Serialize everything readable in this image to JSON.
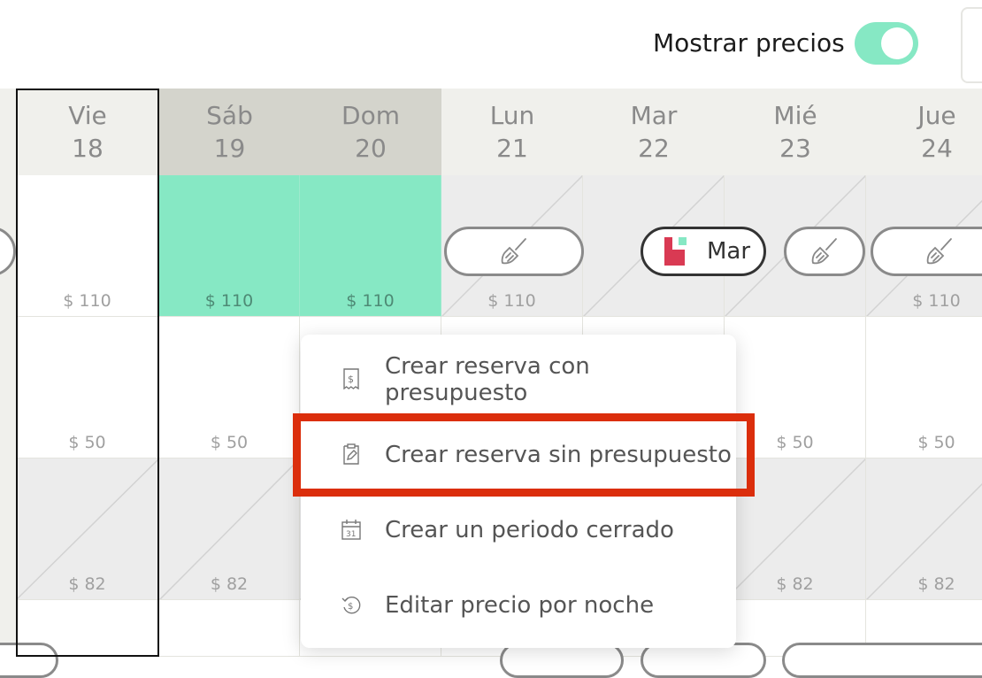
{
  "topbar": {
    "toggle_label": "Mostrar precios",
    "toggle_on": true
  },
  "days": [
    {
      "name": "Vie",
      "num": "18",
      "weekend": false
    },
    {
      "name": "Sáb",
      "num": "19",
      "weekend": true
    },
    {
      "name": "Dom",
      "num": "20",
      "weekend": true
    },
    {
      "name": "Lun",
      "num": "21",
      "weekend": false
    },
    {
      "name": "Mar",
      "num": "22",
      "weekend": false
    },
    {
      "name": "Mié",
      "num": "23",
      "weekend": false
    },
    {
      "name": "Jue",
      "num": "24",
      "weekend": false
    }
  ],
  "rows": [
    {
      "prices": [
        "$ 110",
        "$ 110",
        "$ 110",
        "$ 110",
        "",
        "",
        "$ 110"
      ],
      "states": [
        "open",
        "booked",
        "booked",
        "blocked",
        "blocked",
        "blocked",
        "blocked"
      ]
    },
    {
      "prices": [
        "$ 50",
        "$ 50",
        "",
        "",
        "",
        "$ 50",
        "$ 50"
      ],
      "states": [
        "open",
        "open",
        "open",
        "open",
        "open",
        "open",
        "open"
      ]
    },
    {
      "prices": [
        "$ 82",
        "$ 82",
        "",
        "",
        "",
        "$ 82",
        "$ 82"
      ],
      "states": [
        "blocked",
        "blocked",
        "blocked",
        "blocked",
        "blocked",
        "blocked",
        "blocked"
      ]
    },
    {
      "prices": [
        "",
        "",
        "",
        "",
        "",
        "",
        ""
      ],
      "states": [
        "open",
        "open",
        "open",
        "open",
        "open",
        "open",
        "open"
      ]
    }
  ],
  "reservation": {
    "guest_name": "Mar"
  },
  "context_menu": {
    "items": [
      {
        "label": "Crear reserva con presupuesto",
        "icon": "receipt-icon"
      },
      {
        "label": "Crear reserva sin presupuesto",
        "icon": "edit-document-icon"
      },
      {
        "label": "Crear un periodo cerrado",
        "icon": "calendar-icon"
      },
      {
        "label": "Editar precio por noche",
        "icon": "price-history-icon"
      }
    ],
    "highlighted_index": 1
  },
  "colors": {
    "booked": "#86e8c4",
    "highlight": "#db2e0c",
    "guest_logo": "#d93a53",
    "toggle": "#86e8c4"
  }
}
